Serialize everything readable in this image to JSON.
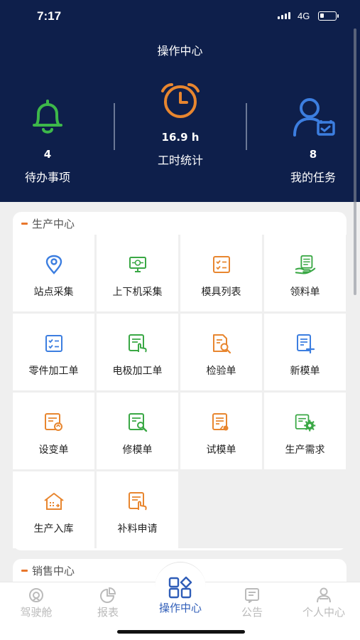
{
  "status": {
    "time": "7:17",
    "network": "4G"
  },
  "header": {
    "title": "操作中心",
    "stats": [
      {
        "value": "4",
        "label": "待办事项",
        "icon": "bell-icon"
      },
      {
        "value": "16.9 h",
        "label": "工时统计",
        "icon": "alarm-clock-icon"
      },
      {
        "value": "8",
        "label": "我的任务",
        "icon": "user-task-icon"
      }
    ]
  },
  "production": {
    "title": "生产中心",
    "items": [
      {
        "label": "站点采集",
        "icon": "location-pin-icon"
      },
      {
        "label": "上下机采集",
        "icon": "monitor-icon"
      },
      {
        "label": "模具列表",
        "icon": "checklist-icon"
      },
      {
        "label": "领料单",
        "icon": "hand-document-icon"
      },
      {
        "label": "零件加工单",
        "icon": "checklist-icon"
      },
      {
        "label": "电极加工单",
        "icon": "document-tap-icon"
      },
      {
        "label": "检验单",
        "icon": "document-search-icon"
      },
      {
        "label": "新模单",
        "icon": "document-add-icon"
      },
      {
        "label": "设变单",
        "icon": "document-refresh-icon"
      },
      {
        "label": "修模单",
        "icon": "document-wrench-icon"
      },
      {
        "label": "试模单",
        "icon": "document-dot-icon"
      },
      {
        "label": "生产需求",
        "icon": "document-gear-icon"
      },
      {
        "label": "生产入库",
        "icon": "warehouse-icon"
      },
      {
        "label": "补料申请",
        "icon": "document-tap-icon"
      }
    ]
  },
  "sales": {
    "title": "销售中心"
  },
  "tabs": [
    {
      "label": "驾驶舱",
      "icon": "cockpit-icon"
    },
    {
      "label": "报表",
      "icon": "pie-chart-icon"
    },
    {
      "label": "操作中心",
      "icon": "grid-apps-icon"
    },
    {
      "label": "公告",
      "icon": "notice-icon"
    },
    {
      "label": "个人中心",
      "icon": "person-icon"
    }
  ],
  "colors": {
    "header_bg": "#0e1f4b",
    "accent_orange": "#e8762b",
    "green": "#3aa845",
    "blue": "#3c7ee0",
    "active_tab": "#2f5db8"
  }
}
